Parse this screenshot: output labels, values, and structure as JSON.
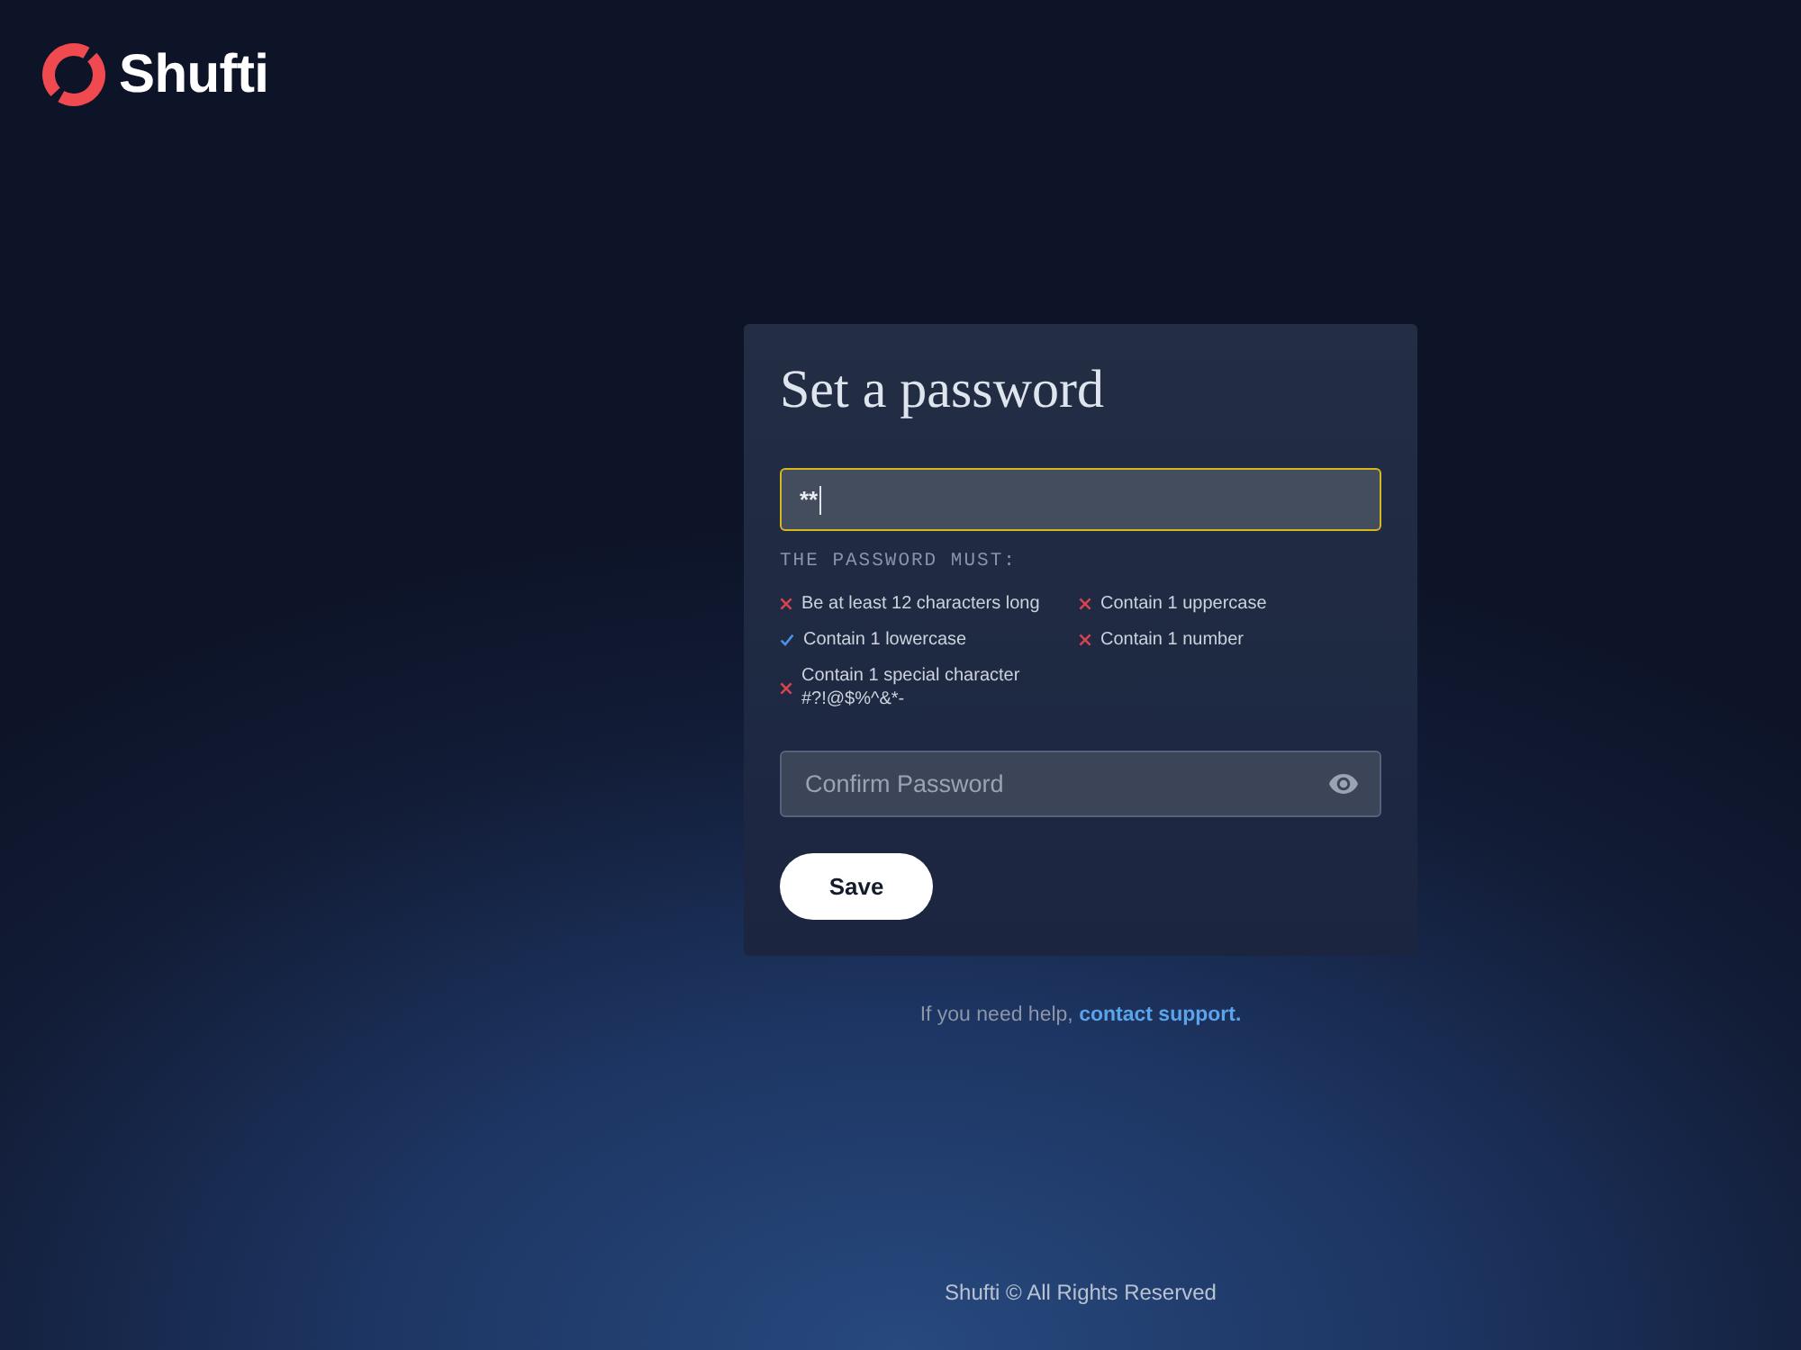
{
  "logo": {
    "text": "Shufti"
  },
  "card": {
    "title": "Set a password",
    "password_field": {
      "value": "**",
      "focused": true
    },
    "requirements_heading": "THE PASSWORD MUST:",
    "requirements": [
      {
        "text": "Be at least 12 characters long",
        "met": false
      },
      {
        "text": "Contain 1 uppercase",
        "met": false
      },
      {
        "text": "Contain 1 lowercase",
        "met": true
      },
      {
        "text": "Contain 1 number",
        "met": false
      },
      {
        "text": "Contain 1 special character #?!@$%^&*-",
        "met": false
      }
    ],
    "confirm_field": {
      "placeholder": "Confirm Password"
    },
    "save_button": "Save"
  },
  "help": {
    "text": "If you need help,",
    "link": "contact support."
  },
  "footer": "Shufti © All Rights Reserved"
}
